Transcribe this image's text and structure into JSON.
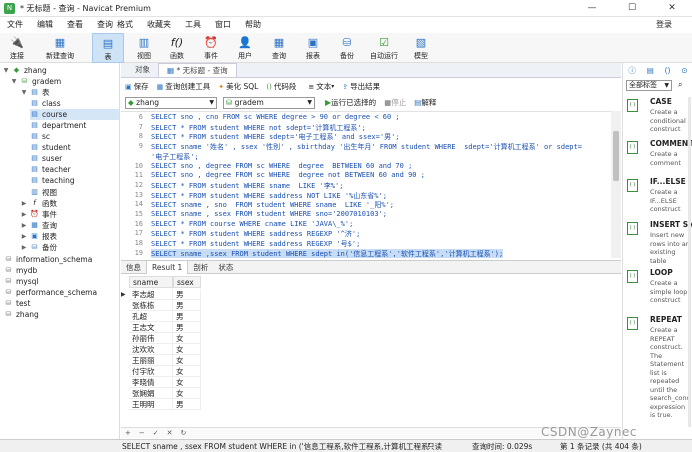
{
  "window": {
    "title": "* 无标题 - 查询 - Navicat Premium",
    "app_icon": "N"
  },
  "menu": {
    "items": [
      "文件",
      "编辑",
      "查看",
      "查询",
      "格式",
      "收藏夹",
      "工具",
      "窗口",
      "帮助"
    ],
    "login": "登录"
  },
  "toolbar": {
    "items": [
      {
        "label": "连接",
        "icon": "plug-icon"
      },
      {
        "label": "新建查询",
        "icon": "new-query-icon"
      },
      {
        "label": "表",
        "icon": "table-icon",
        "active": true
      },
      {
        "label": "视图",
        "icon": "view-icon"
      },
      {
        "label": "函数",
        "icon": "function-icon"
      },
      {
        "label": "事件",
        "icon": "event-icon"
      },
      {
        "label": "用户",
        "icon": "user-icon"
      },
      {
        "label": "查询",
        "icon": "query-icon"
      },
      {
        "label": "报表",
        "icon": "report-icon"
      },
      {
        "label": "备份",
        "icon": "backup-icon"
      },
      {
        "label": "自动运行",
        "icon": "autorun-icon"
      },
      {
        "label": "模型",
        "icon": "model-icon"
      }
    ]
  },
  "tree": {
    "connection": "zhang",
    "database": "gradem",
    "tables_node": "表",
    "tables": [
      "class",
      "course",
      "department",
      "sc",
      "student",
      "suser",
      "teacher",
      "teaching"
    ],
    "selected_table": "course",
    "nodes": [
      "视图",
      "函数",
      "事件",
      "查询",
      "报表",
      "备份"
    ],
    "other_dbs": [
      "information_schema",
      "mydb",
      "mysql",
      "performance_schema",
      "test",
      "zhang"
    ]
  },
  "tabs": {
    "objects": "对象",
    "query": "* 无标题 - 查询"
  },
  "query_toolbar": {
    "save": "保存",
    "builder": "查询创建工具",
    "beautify": "美化 SQL",
    "snippet": "代码段",
    "text": "文本",
    "export": "导出结果"
  },
  "selectors": {
    "connection": "zhang",
    "database": "gradem",
    "run": "运行已选择的",
    "stop": "停止",
    "explain": "解释"
  },
  "editor": {
    "lines": [
      {
        "n": "6",
        "text": "SELECT sno , cno FROM sc WHERE degree > 90 or degree < 60 ;"
      },
      {
        "n": "7",
        "text": "SELECT * FROM student WHERE not sdept='计算机工程系';"
      },
      {
        "n": "8",
        "text": "SELECT * FROM student WHERE sdept='电子工程系' and ssex='男';"
      },
      {
        "n": "9",
        "text": "SELECT sname '姓名' , ssex '性别' , sbirthday '出生年月' FROM student WHERE  sdept='计算机工程系' or sdept="
      },
      {
        "n": "",
        "text": "'电子工程系';"
      },
      {
        "n": "10",
        "text": "SELECT sno , degree FROM sc WHERE  degree  BETWEEN 60 and 70 ;"
      },
      {
        "n": "11",
        "text": "SELECT sno , degree FROM sc WHERE  degree not BETWEEN 60 and 90 ;"
      },
      {
        "n": "12",
        "text": "SELECT * FROM student WHERE sname  LIKE '李%';"
      },
      {
        "n": "13",
        "text": "SELECT * FROM student WHERE saddress NOT LIKE '%山东省%';"
      },
      {
        "n": "14",
        "text": "SELECT sname , sno  FROM student WHERE sname  LIKE '_阳%';"
      },
      {
        "n": "15",
        "text": "SELECT sname , ssex FROM student WHERE sno='2007010103';"
      },
      {
        "n": "16",
        "text": "SELECT * FROM course WHERE cname LIKE 'JAVA\\_%';"
      },
      {
        "n": "17",
        "text": "SELECT * FROM student WHERE saddress REGEXP '^济';"
      },
      {
        "n": "18",
        "text": "SELECT * FROM student WHERE saddress REGEXP '号$';"
      },
      {
        "n": "19",
        "text": "SELECT sname ,ssex FROM student WHERE sdept in('信息工程系','软件工程系','计算机工程系');"
      }
    ]
  },
  "result_tabs": [
    "信息",
    "Result 1",
    "剖析",
    "状态"
  ],
  "grid": {
    "columns": [
      "sname",
      "ssex"
    ],
    "rows": [
      [
        "李志超",
        "男"
      ],
      [
        "张栋栋",
        "男"
      ],
      [
        "孔超",
        "男"
      ],
      [
        "王志文",
        "男"
      ],
      [
        "孙丽伟",
        "女"
      ],
      [
        "沈欢欢",
        "女"
      ],
      [
        "王丽丽",
        "女"
      ],
      [
        "付宇欣",
        "女"
      ],
      [
        "李晓倩",
        "女"
      ],
      [
        "张娴娟",
        "女"
      ],
      [
        "王明明",
        "男"
      ]
    ]
  },
  "right_pane": {
    "filter": "全部标签",
    "snippets": [
      {
        "title": "CASE",
        "desc": "Create a conditional construct"
      },
      {
        "title": "COMMENT",
        "desc": "Create a comment"
      },
      {
        "title": "IF...ELSE",
        "desc": "Create a IF...ELSE construct"
      },
      {
        "title": "INSERT Sy",
        "desc": "Insert new rows into an existing table"
      },
      {
        "title": "LOOP",
        "desc": "Create a simple loop construct"
      },
      {
        "title": "REPEAT",
        "desc": "Create a REPEAT construct. The Statement list is repeated until the search_cond expression is true."
      }
    ]
  },
  "status": {
    "sql": "SELECT sname , ssex FROM student WHERE in ('信息工程系,软件工程系,计算机工程系'",
    "mode": "只读",
    "time": "查询时间: 0.029s",
    "records": "第 1 条记录 (共 404 条)"
  },
  "watermark": "CSDN@Zaynec"
}
